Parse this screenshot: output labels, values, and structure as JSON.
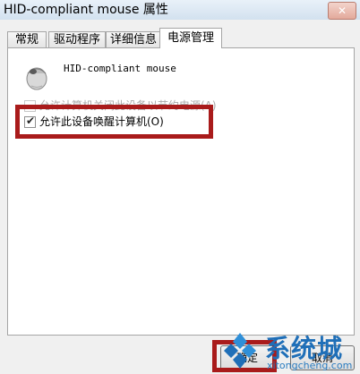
{
  "window": {
    "title": "HID-compliant mouse 属性",
    "close_glyph": "✕"
  },
  "tabs": [
    {
      "label": "常规",
      "active": false
    },
    {
      "label": "驱动程序",
      "active": false
    },
    {
      "label": "详细信息",
      "active": false
    },
    {
      "label": "电源管理",
      "active": true
    }
  ],
  "device": {
    "name": "HID-compliant mouse",
    "icon": "mouse-icon"
  },
  "power": {
    "option1_label": "允许计算机关闭此设备以节约电源(A)",
    "option1_checked": true,
    "option1_enabled": false,
    "option2_label": "允许此设备唤醒计算机(O)",
    "option2_checked": true
  },
  "buttons": {
    "ok_label": "确定",
    "cancel_label": "取消"
  },
  "watermark": {
    "brand": "系统城",
    "url": "xitongcheng.com"
  },
  "colors": {
    "highlight": "#a91b1b",
    "watermark_blue": "#1f6fb8"
  }
}
